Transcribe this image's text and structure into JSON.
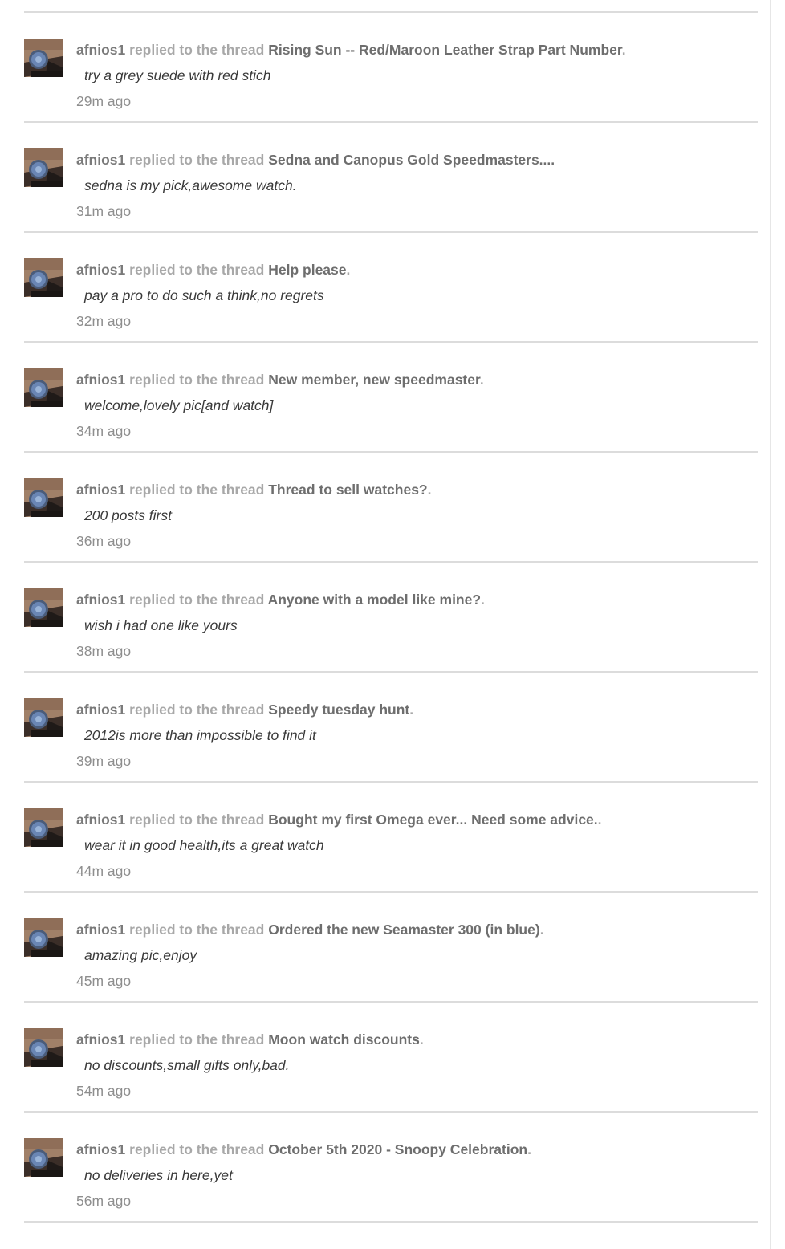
{
  "feed": {
    "username": "afnios1",
    "action_text": " replied to the thread ",
    "items": [
      {
        "thread": "Rising Sun -- Red/Maroon Leather Strap Part Number",
        "excerpt": "try a grey suede with red stich",
        "time": "29m ago"
      },
      {
        "thread": "Sedna and Canopus Gold Speedmasters....",
        "excerpt": "sedna is my pick,awesome watch.",
        "time": "31m ago"
      },
      {
        "thread": "Help please",
        "excerpt": "pay a pro to do such a think,no regrets",
        "time": "32m ago"
      },
      {
        "thread": "New member, new speedmaster",
        "excerpt": "welcome,lovely pic[and watch]",
        "time": "34m ago"
      },
      {
        "thread": "Thread to sell watches?",
        "excerpt": "200 posts first",
        "time": "36m ago"
      },
      {
        "thread": "Anyone with a model like mine?",
        "excerpt": "wish i had one like yours",
        "time": "38m ago"
      },
      {
        "thread": "Speedy tuesday hunt",
        "excerpt": "2012is more than impossible to find it",
        "time": "39m ago"
      },
      {
        "thread": "Bought my first Omega ever... Need some advice.",
        "excerpt": "wear it in good health,its a great watch",
        "time": "44m ago"
      },
      {
        "thread": "Ordered the new Seamaster 300 (in blue)",
        "excerpt": "amazing pic,enjoy",
        "time": "45m ago"
      },
      {
        "thread": "Moon watch discounts",
        "excerpt": "no discounts,small gifts only,bad.",
        "time": "54m ago"
      },
      {
        "thread": "October 5th 2020 - Snoopy Celebration",
        "excerpt": "no deliveries in here,yet",
        "time": "56m ago"
      }
    ],
    "title_suffix": "."
  },
  "colors": {
    "username": "#7a7a7a",
    "action": "#a8a8a8",
    "thread": "#6e6e6e",
    "excerpt": "#3a3a3a",
    "time": "#8e8e8e",
    "divider": "#dcdcdc"
  },
  "icons": {
    "avatar": "user-avatar-watch-on-wrist"
  }
}
